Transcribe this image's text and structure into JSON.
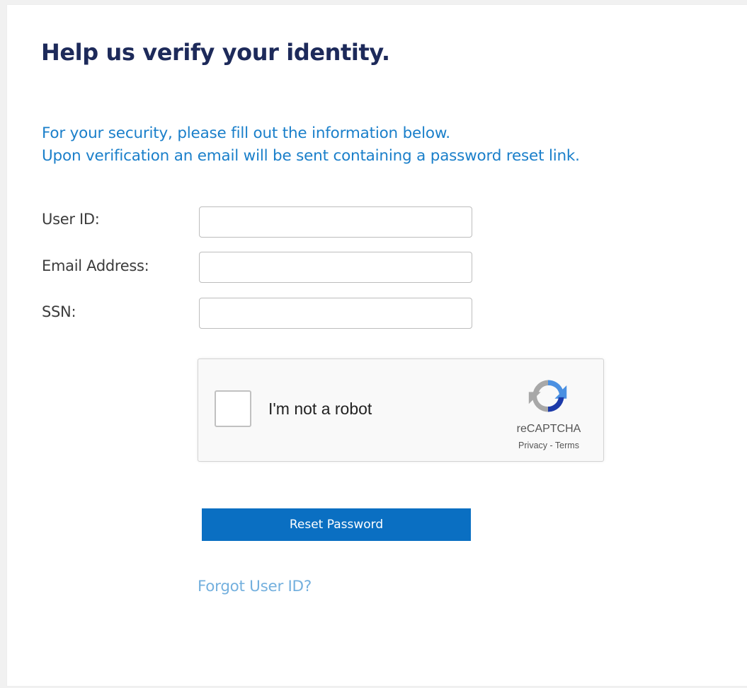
{
  "page": {
    "heading": "Help us verify your identity.",
    "intro_line_1": "For your security, please fill out the information below.",
    "intro_line_2": "Upon verification an email will be sent containing a password reset link."
  },
  "form": {
    "user_id": {
      "label": "User ID:",
      "value": ""
    },
    "email": {
      "label": "Email Address:",
      "value": ""
    },
    "ssn": {
      "label": "SSN:",
      "value": ""
    }
  },
  "captcha": {
    "checked": false,
    "label": "I'm not a robot",
    "brand": "reCAPTCHA",
    "privacy_label": "Privacy",
    "separator": " - ",
    "terms_label": "Terms",
    "icon": "recaptcha-logo-icon"
  },
  "actions": {
    "reset_label": "Reset Password",
    "forgot_user_id_label": "Forgot User ID?"
  },
  "colors": {
    "heading": "#1d2a5a",
    "intro": "#1a7fca",
    "button": "#0a6fc2",
    "link": "#74b0de"
  }
}
